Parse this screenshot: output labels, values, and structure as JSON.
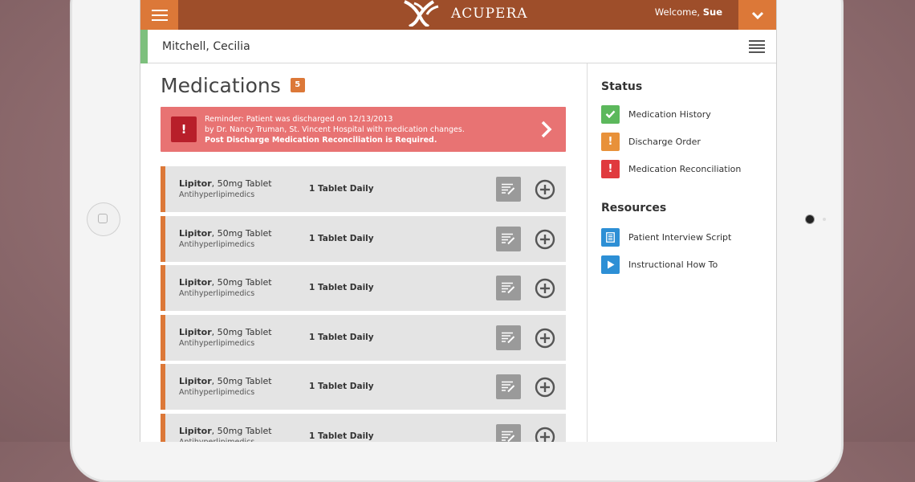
{
  "app": {
    "logo_text": "ACUPERA",
    "welcome_prefix": "Welcome, ",
    "welcome_user": "Sue"
  },
  "patient": {
    "name": "Mitchell, Cecilia"
  },
  "medications": {
    "title": "Medications",
    "count": "5",
    "alert": {
      "icon": "!",
      "line1": "Reminder: Patient was discharged on 12/13/2013",
      "line2": "by Dr. Nancy Truman, St. Vincent Hospital with medication changes.",
      "line3": "Post Discharge Medication Reconciliation is Required."
    },
    "items": [
      {
        "name": "Lipitor",
        "detail": ", 50mg Tablet",
        "drug_class": "Antihyperlipimedics",
        "dose": "1 Tablet Daily"
      },
      {
        "name": "Lipitor",
        "detail": ", 50mg Tablet",
        "drug_class": "Antihyperlipimedics",
        "dose": "1 Tablet Daily"
      },
      {
        "name": "Lipitor",
        "detail": ", 50mg Tablet",
        "drug_class": "Antihyperlipimedics",
        "dose": "1 Tablet Daily"
      },
      {
        "name": "Lipitor",
        "detail": ", 50mg Tablet",
        "drug_class": "Antihyperlipimedics",
        "dose": "1 Tablet Daily"
      },
      {
        "name": "Lipitor",
        "detail": ", 50mg Tablet",
        "drug_class": "Antihyperlipimedics",
        "dose": "1 Tablet Daily"
      },
      {
        "name": "Lipitor",
        "detail": ", 50mg Tablet",
        "drug_class": "Antihyperlipimedics",
        "dose": "1 Tablet Daily"
      }
    ]
  },
  "sidebar": {
    "status_heading": "Status",
    "status_items": [
      {
        "label": "Medication History",
        "icon": "check-icon",
        "color": "#5cb85c"
      },
      {
        "label": "Discharge Order",
        "icon": "exclamation-icon",
        "glyph": "!",
        "color": "#e8913a"
      },
      {
        "label": "Medication Reconciliation",
        "icon": "exclamation-icon",
        "glyph": "!",
        "color": "#e03a3e"
      }
    ],
    "resources_heading": "Resources",
    "resource_items": [
      {
        "label": "Patient Interview Script",
        "icon": "document-icon",
        "color": "#2d8fd5"
      },
      {
        "label": "Instructional How To",
        "icon": "play-icon",
        "color": "#2d8fd5"
      }
    ]
  },
  "colors": {
    "topbar": "#9e4e2a",
    "accent_orange": "#dc7838",
    "alert_bg": "#e87373",
    "alert_icon_bg": "#b81f2a",
    "patient_accent": "#7dc07d"
  }
}
